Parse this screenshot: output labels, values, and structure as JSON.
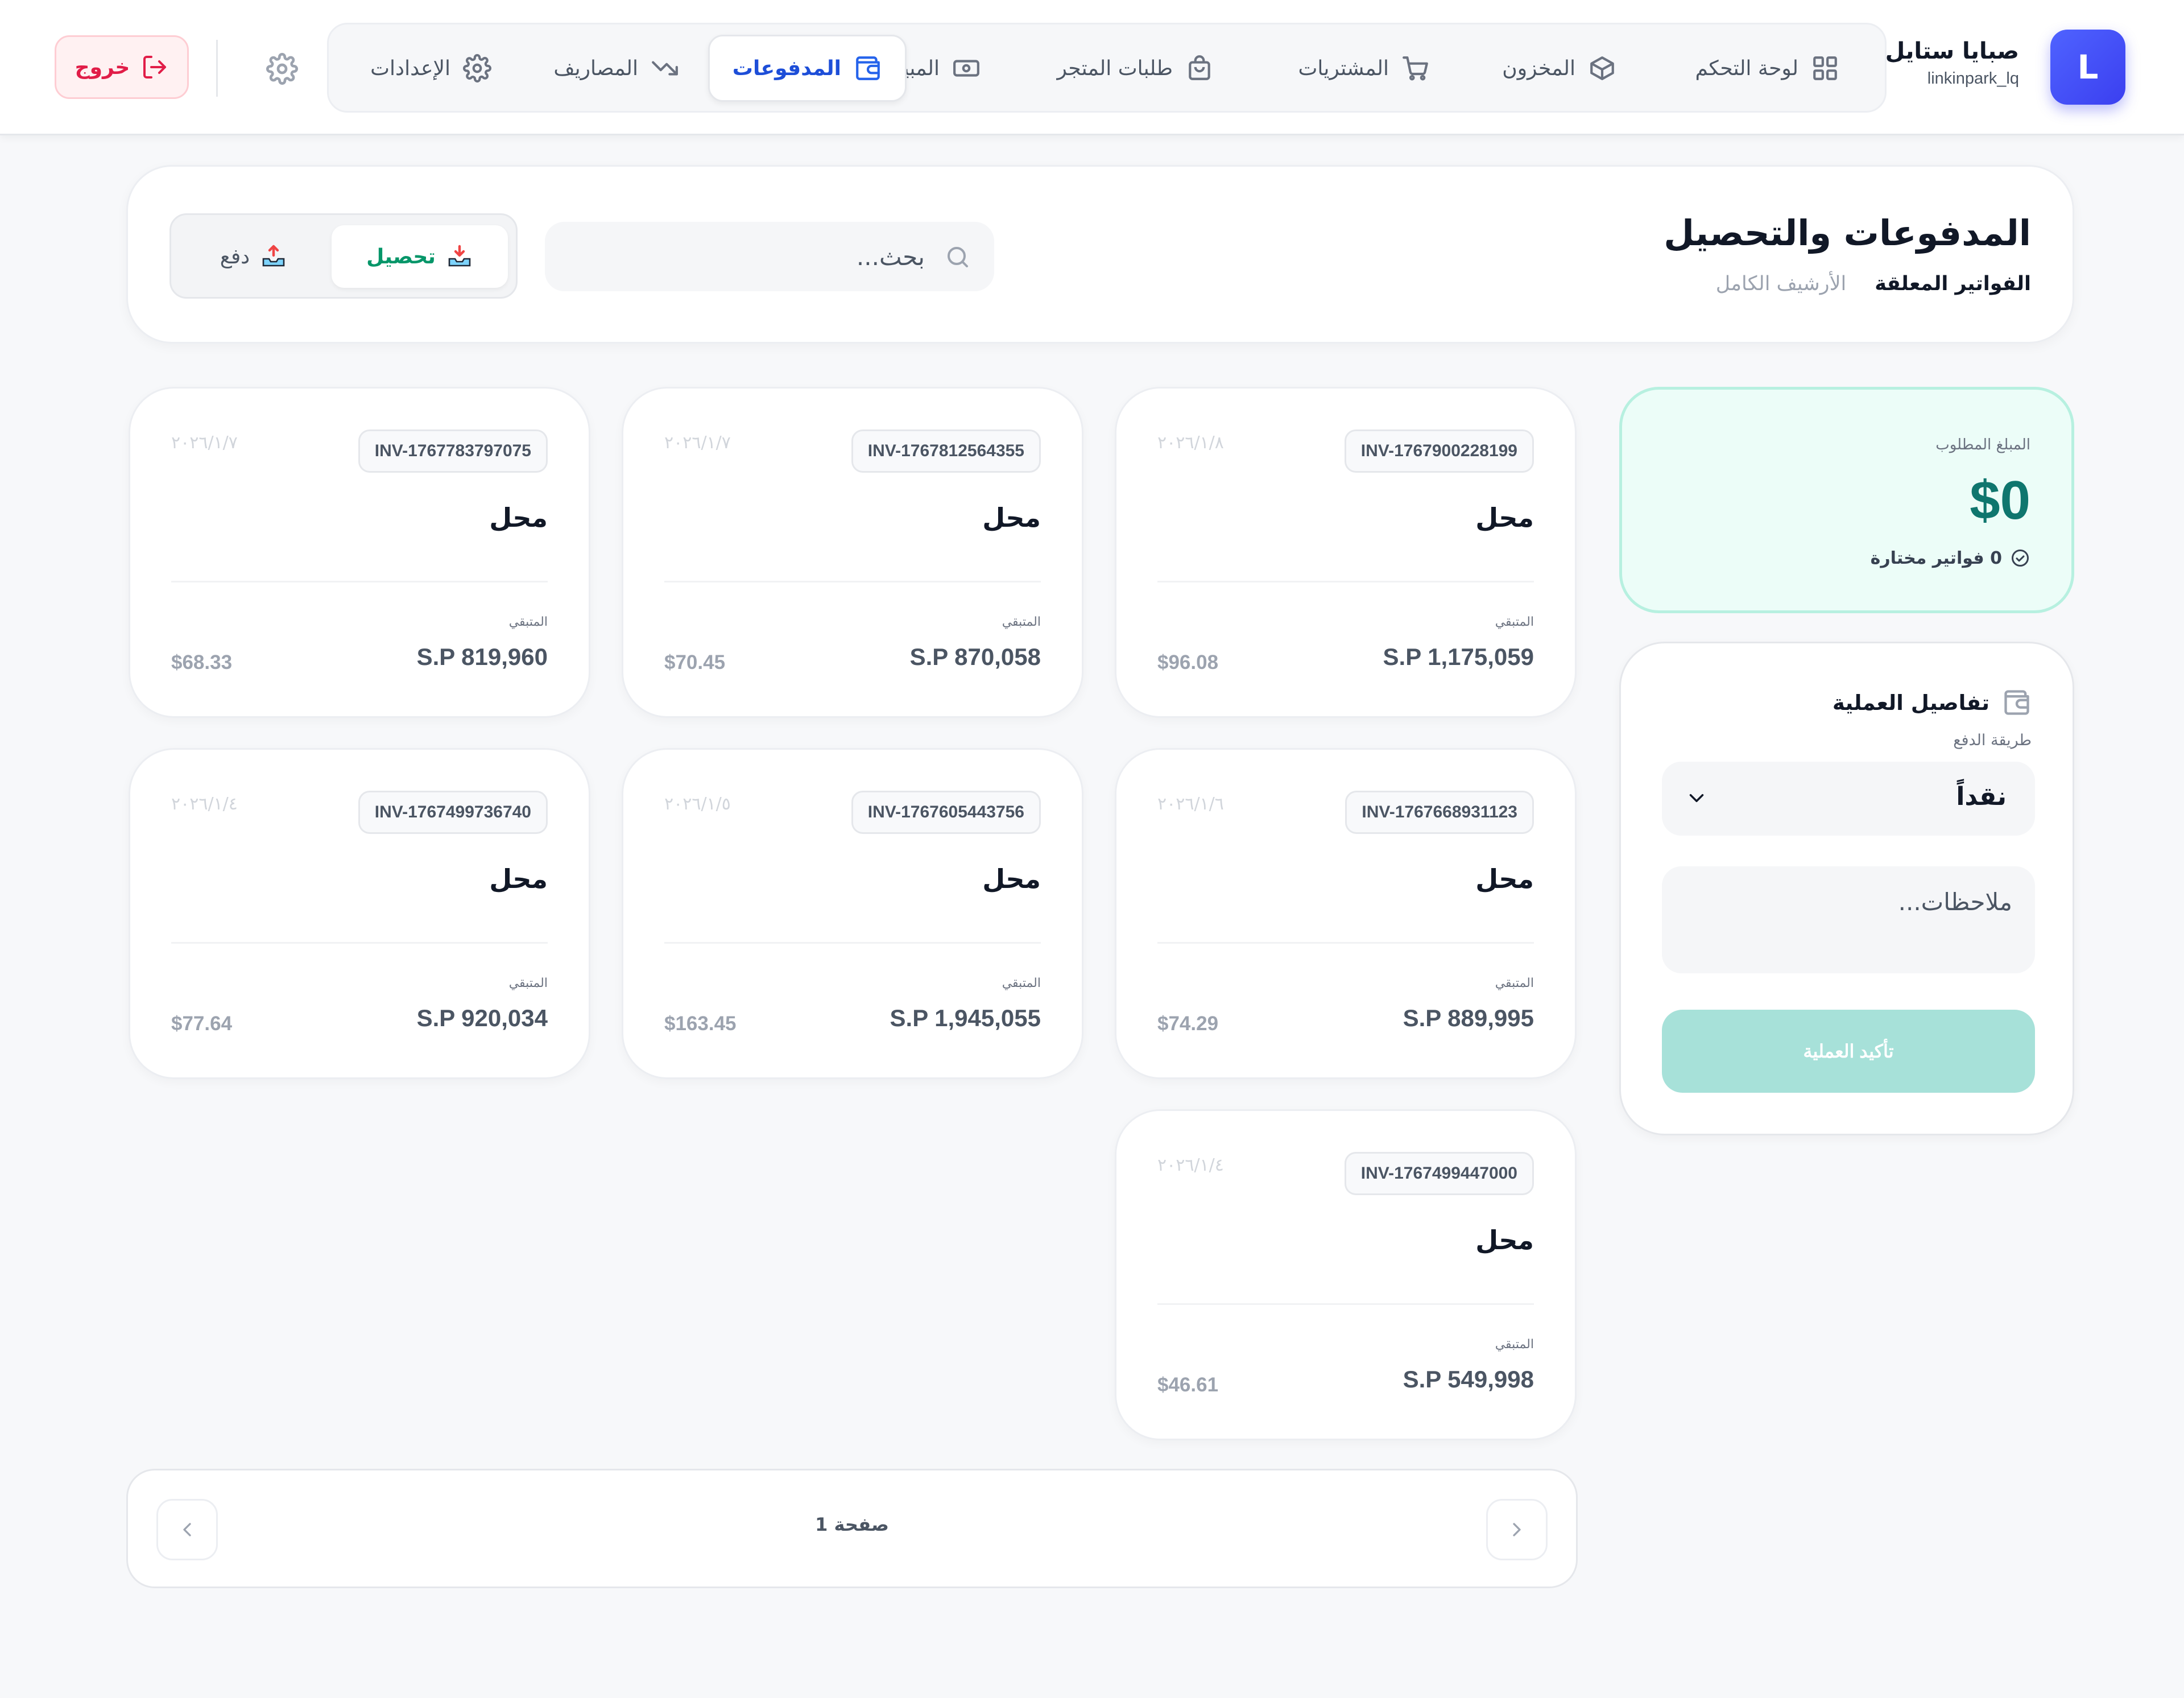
{
  "app": {
    "avatar_letter": "L",
    "brand_name": "صبايا ستايل",
    "username": "linkinpark_lq"
  },
  "nav": [
    {
      "label": "لوحة التحكم",
      "icon": "grid-icon"
    },
    {
      "label": "المخزون",
      "icon": "box-icon"
    },
    {
      "label": "المشتريات",
      "icon": "cart-icon"
    },
    {
      "label": "طلبات المتجر",
      "icon": "bag-icon"
    },
    {
      "label": "المبيعات",
      "icon": "banknote-icon"
    },
    {
      "label": "المدفوعات",
      "icon": "wallet-icon",
      "active": true
    },
    {
      "label": "المصاريف",
      "icon": "trend-down-icon"
    },
    {
      "label": "الإعدادات",
      "icon": "gear-icon"
    }
  ],
  "logout_label": "خروج",
  "header": {
    "title": "المدفوعات والتحصيل",
    "tabs": [
      {
        "label": "الفواتير المعلقة",
        "active": true
      },
      {
        "label": "الأرشيف الكامل",
        "active": false
      }
    ],
    "search_placeholder": "بحث...",
    "toggle": {
      "collect_label": "تحصيل",
      "pay_label": "دفع",
      "active": "collect"
    }
  },
  "summary": {
    "amount_label": "المبلغ المطلوب",
    "amount_value": "$0",
    "selected_text": "0 فواتير مختارة"
  },
  "details": {
    "title": "تفاصيل العملية",
    "method_label": "طريقة الدفع",
    "method_value": "نقداً",
    "notes_placeholder": "ملاحظات...",
    "confirm_label": "تأكيد العملية"
  },
  "invoices": [
    {
      "id": "INV-1767900228199",
      "date": "٢٠٢٦/١/٨",
      "name": "محل",
      "remaining_label": "المتبقي",
      "amount": "S.P 1,175,059",
      "usd": "$96.08"
    },
    {
      "id": "INV-1767812564355",
      "date": "٢٠٢٦/١/٧",
      "name": "محل",
      "remaining_label": "المتبقي",
      "amount": "S.P 870,058",
      "usd": "$70.45"
    },
    {
      "id": "INV-1767783797075",
      "date": "٢٠٢٦/١/٧",
      "name": "محل",
      "remaining_label": "المتبقي",
      "amount": "S.P 819,960",
      "usd": "$68.33"
    },
    {
      "id": "INV-1767668931123",
      "date": "٢٠٢٦/١/٦",
      "name": "محل",
      "remaining_label": "المتبقي",
      "amount": "S.P 889,995",
      "usd": "$74.29"
    },
    {
      "id": "INV-1767605443756",
      "date": "٢٠٢٦/١/٥",
      "name": "محل",
      "remaining_label": "المتبقي",
      "amount": "S.P 1,945,055",
      "usd": "$163.45"
    },
    {
      "id": "INV-1767499736740",
      "date": "٢٠٢٦/١/٤",
      "name": "محل",
      "remaining_label": "المتبقي",
      "amount": "S.P 920,034",
      "usd": "$77.64"
    },
    {
      "id": "INV-1767499447000",
      "date": "٢٠٢٦/١/٤",
      "name": "محل",
      "remaining_label": "المتبقي",
      "amount": "S.P 549,998",
      "usd": "$46.61"
    }
  ],
  "pagination": {
    "label": "صفحة 1"
  },
  "colors": {
    "accent": "#2563eb",
    "success": "#0f766e",
    "danger": "#e11d48",
    "confirm_disabled": "#a7e1d9"
  }
}
